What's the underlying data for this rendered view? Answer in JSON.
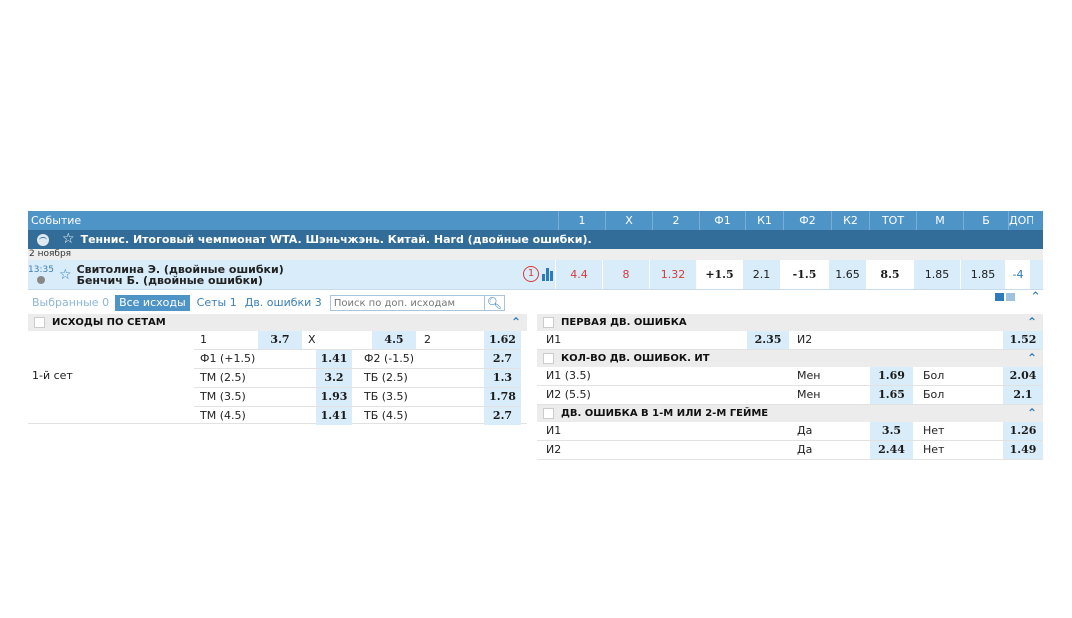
{
  "header": {
    "event_label": "Событие",
    "columns": [
      "1",
      "X",
      "2",
      "Ф1",
      "К1",
      "Ф2",
      "К2",
      "ТОТ",
      "М",
      "Б",
      "ДОП"
    ]
  },
  "league": {
    "title": "Теннис. Итоговый чемпионат WTA. Шэньчжэнь. Китай. Hard (двойные ошибки)."
  },
  "date": "2 ноября",
  "event": {
    "time": "13:35",
    "team1": "Свитолина Э. (двойные ошибки)",
    "team2": "Бенчич Б. (двойные ошибки)",
    "stat_badge": "1",
    "cells": [
      "4.4",
      "8",
      "1.32",
      "+1.5",
      "2.1",
      "-1.5",
      "1.65",
      "8.5",
      "1.85",
      "1.85",
      "-4"
    ]
  },
  "filters": {
    "selected": "Выбранные 0",
    "all": "Все исходы",
    "sets": "Сеты 1",
    "double_faults": "Дв. ошибки 3",
    "search_placeholder": "Поиск по доп. исходам"
  },
  "sets_panel": {
    "title": "ИСХОДЫ ПО СЕТАМ",
    "set_label": "1-й сет",
    "rows": [
      {
        "a": "1",
        "av": "3.7",
        "b": "X",
        "bv": "4.5",
        "c": "2",
        "cv": "1.62"
      },
      {
        "b": "Ф1 (+1.5)",
        "bv": "1.41",
        "c": "Ф2 (-1.5)",
        "cv": "2.7"
      },
      {
        "b": "ТМ (2.5)",
        "bv": "3.2",
        "c": "ТБ (2.5)",
        "cv": "1.3"
      },
      {
        "b": "ТМ (3.5)",
        "bv": "1.93",
        "c": "ТБ (3.5)",
        "cv": "1.78"
      },
      {
        "b": "ТМ (4.5)",
        "bv": "1.41",
        "c": "ТБ (4.5)",
        "cv": "2.7"
      }
    ]
  },
  "first_df": {
    "title": "ПЕРВАЯ ДВ. ОШИБКА",
    "row": {
      "a": "И1",
      "av": "2.35",
      "b": "И2",
      "bv": "1.52"
    }
  },
  "count_df": {
    "title": "КОЛ-ВО ДВ. ОШИБОК. ИТ",
    "rows": [
      {
        "a": "И1 (3.5)",
        "b": "Мен",
        "bv": "1.69",
        "c": "Бол",
        "cv": "2.04"
      },
      {
        "a": "И2 (5.5)",
        "b": "Мен",
        "bv": "1.65",
        "c": "Бол",
        "cv": "2.1"
      }
    ]
  },
  "df_games": {
    "title": "ДВ. ОШИБКА В 1-М ИЛИ 2-М ГЕЙМЕ",
    "rows": [
      {
        "a": "И1",
        "b": "Да",
        "bv": "3.5",
        "c": "Нет",
        "cv": "1.26"
      },
      {
        "a": "И2",
        "b": "Да",
        "bv": "2.44",
        "c": "Нет",
        "cv": "1.49"
      }
    ]
  }
}
